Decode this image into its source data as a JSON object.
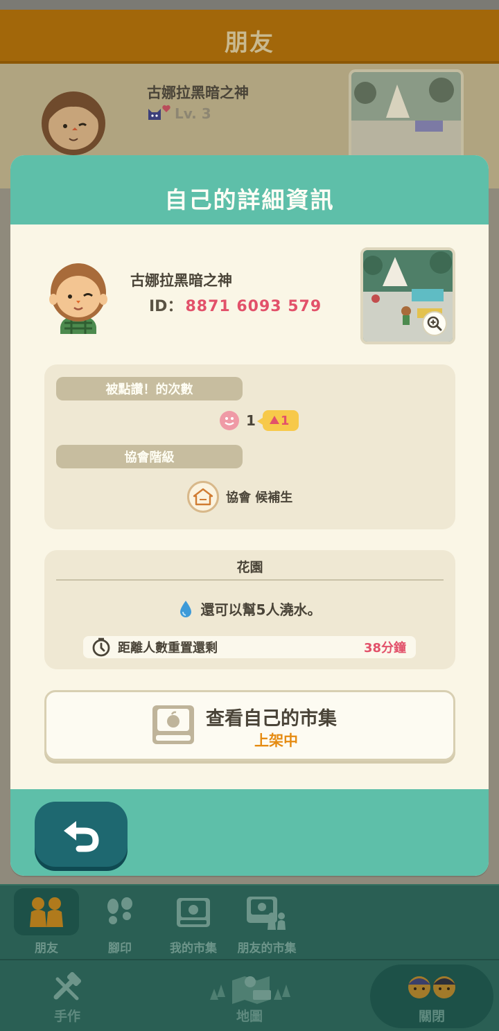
{
  "background": {
    "header_title": "朋友",
    "friend": {
      "name": "古娜拉黑暗之神",
      "level": "Lv. 3"
    }
  },
  "modal": {
    "title": "自己的詳細資訊",
    "profile": {
      "name": "古娜拉黑暗之神",
      "id_label": "ID：",
      "id_value": "8871 6093 579"
    },
    "likes": {
      "label": "被點讚！的次數",
      "count": "1",
      "new_count": "1"
    },
    "rank": {
      "label": "協會階級",
      "value": "協會 候補生"
    },
    "garden": {
      "title": "花園",
      "water_text": "還可以幫5人澆水。",
      "reset_label": "距離人數重置還剩",
      "reset_value": "38分鐘"
    },
    "market": {
      "title": "查看自己的市集",
      "status": "上架中"
    }
  },
  "tabs": [
    {
      "label": "朋友"
    },
    {
      "label": "腳印"
    },
    {
      "label": "我的市集"
    },
    {
      "label": "朋友的市集"
    }
  ],
  "nav": [
    {
      "label": "手作"
    },
    {
      "label": "地圖"
    },
    {
      "label": "關閉"
    }
  ],
  "colors": {
    "teal": "#5ebfa9",
    "cream": "#faf6e6",
    "pink": "#e2516a",
    "orange": "#e58b12",
    "dark_teal": "#1e6870"
  },
  "icons": [
    "smile-icon",
    "up-arrow-icon",
    "rank-badge-icon",
    "water-drop-icon",
    "timer-icon",
    "market-box-icon",
    "zoom-icon",
    "back-arrow-icon"
  ]
}
